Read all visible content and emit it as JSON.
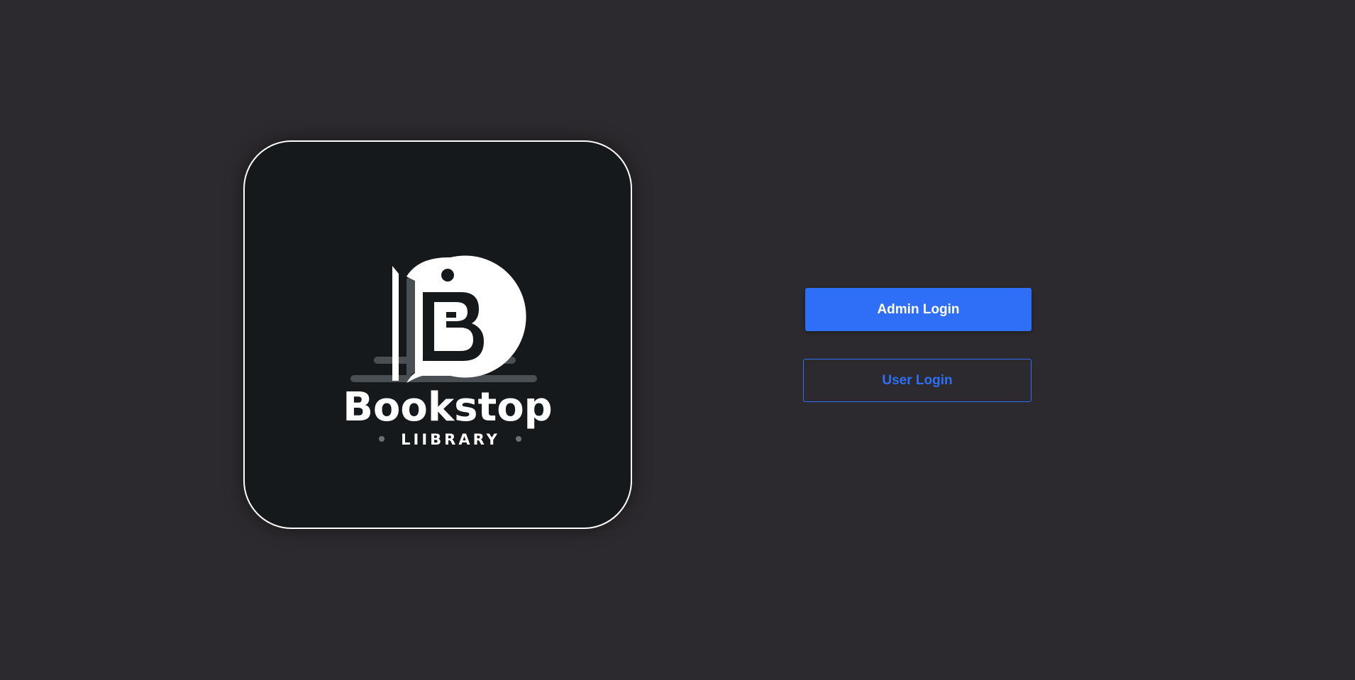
{
  "logo": {
    "brand_name": "Bookstop",
    "brand_subtitle": "LIIBRARY",
    "monogram": "B",
    "colors": {
      "card_background": "#15191c",
      "card_border": "#ffffff",
      "mark": "#ffffff",
      "accent_gray": "#4a4f54"
    }
  },
  "actions": {
    "admin_login_label": "Admin Login",
    "user_login_label": "User Login"
  },
  "theme": {
    "page_background": "#2c2a2e",
    "primary": "#2f6ef6"
  }
}
